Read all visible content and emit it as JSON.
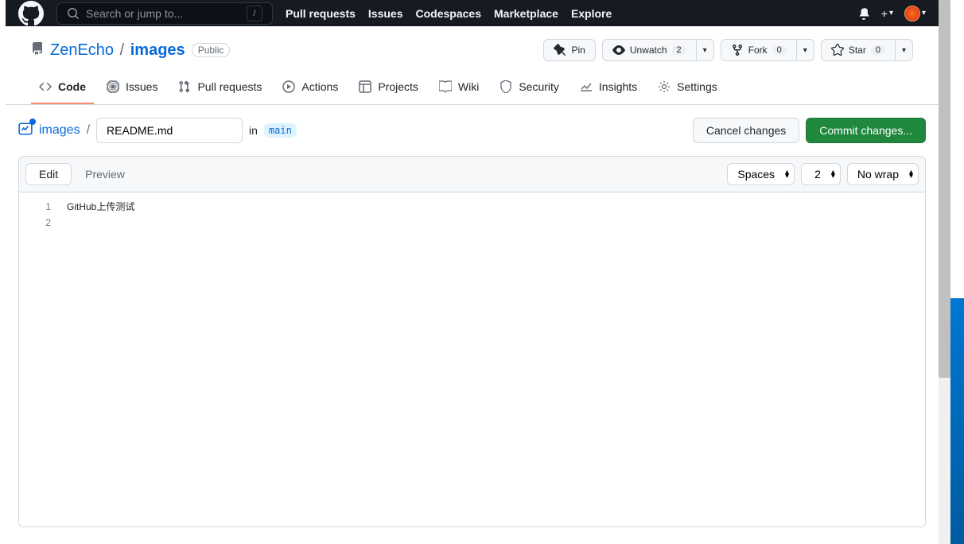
{
  "topbar": {
    "search_placeholder": "Search or jump to...",
    "slash": "/",
    "nav": [
      "Pull requests",
      "Issues",
      "Codespaces",
      "Marketplace",
      "Explore"
    ],
    "plus": "+"
  },
  "repo": {
    "owner": "ZenEcho",
    "name": "images",
    "visibility": "Public",
    "actions": {
      "pin": "Pin",
      "unwatch": "Unwatch",
      "unwatch_count": "2",
      "fork": "Fork",
      "fork_count": "0",
      "star": "Star",
      "star_count": "0"
    },
    "tabs": [
      "Code",
      "Issues",
      "Pull requests",
      "Actions",
      "Projects",
      "Wiki",
      "Security",
      "Insights",
      "Settings"
    ]
  },
  "breadcrumb": {
    "repo_link": "images",
    "filename": "README.md",
    "in": "in",
    "branch": "main",
    "cancel": "Cancel changes",
    "commit": "Commit changes..."
  },
  "editor": {
    "tabs": {
      "edit": "Edit",
      "preview": "Preview"
    },
    "indent_mode": "Spaces",
    "indent_size": "2",
    "wrap": "No wrap",
    "lines": [
      "GitHub上传测试",
      ""
    ]
  }
}
